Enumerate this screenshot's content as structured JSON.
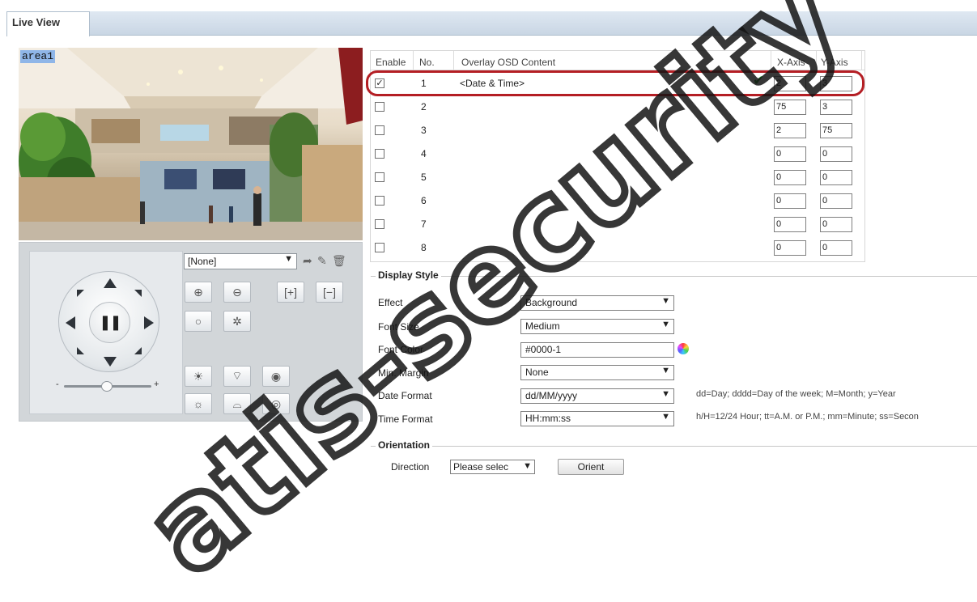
{
  "tabs": {
    "live_view": "Live View"
  },
  "video": {
    "area_label": "area1"
  },
  "ptz": {
    "preset_value": "[None]",
    "zoom_minus": "-",
    "zoom_plus": "+"
  },
  "osd": {
    "headers": {
      "enable": "Enable",
      "no": "No.",
      "content": "Overlay OSD Content",
      "x": "X-Axis",
      "y": "Y-Axis"
    },
    "rows": [
      {
        "no": "1",
        "checked": "✓",
        "content": "<Date & Time>",
        "x": "2",
        "y": "3"
      },
      {
        "no": "2",
        "checked": "",
        "content": "",
        "x": "75",
        "y": "3"
      },
      {
        "no": "3",
        "checked": "",
        "content": "",
        "x": "2",
        "y": "75"
      },
      {
        "no": "4",
        "checked": "",
        "content": "",
        "x": "0",
        "y": "0"
      },
      {
        "no": "5",
        "checked": "",
        "content": "",
        "x": "0",
        "y": "0"
      },
      {
        "no": "6",
        "checked": "",
        "content": "",
        "x": "0",
        "y": "0"
      },
      {
        "no": "7",
        "checked": "",
        "content": "",
        "x": "0",
        "y": "0"
      },
      {
        "no": "8",
        "checked": "",
        "content": "",
        "x": "0",
        "y": "0"
      }
    ]
  },
  "display_style": {
    "legend": "Display Style",
    "effect_label": "Effect",
    "effect_value": "Background",
    "font_size_label": "Font Size",
    "font_size_value": "Medium",
    "font_color_label": "Font Color",
    "font_color_value": "#0000-1",
    "min_margin_label": "Min. Margin",
    "min_margin_value": "None",
    "date_format_label": "Date Format",
    "date_format_value": "dd/MM/yyyy",
    "date_format_hint": "dd=Day; dddd=Day of the week; M=Month; y=Year",
    "time_format_label": "Time Format",
    "time_format_value": "HH:mm:ss",
    "time_format_hint": "h/H=12/24 Hour; tt=A.M. or P.M.; mm=Minute; ss=Secon"
  },
  "orientation": {
    "legend": "Orientation",
    "direction_label": "Direction",
    "direction_value": "Please selec",
    "orient_button": "Orient"
  },
  "watermark": {
    "text": "atis-security"
  },
  "colors": {
    "highlight": "#b41e24",
    "check_valid": "#1b8c25",
    "tab_strip": "#c9d6e4"
  }
}
